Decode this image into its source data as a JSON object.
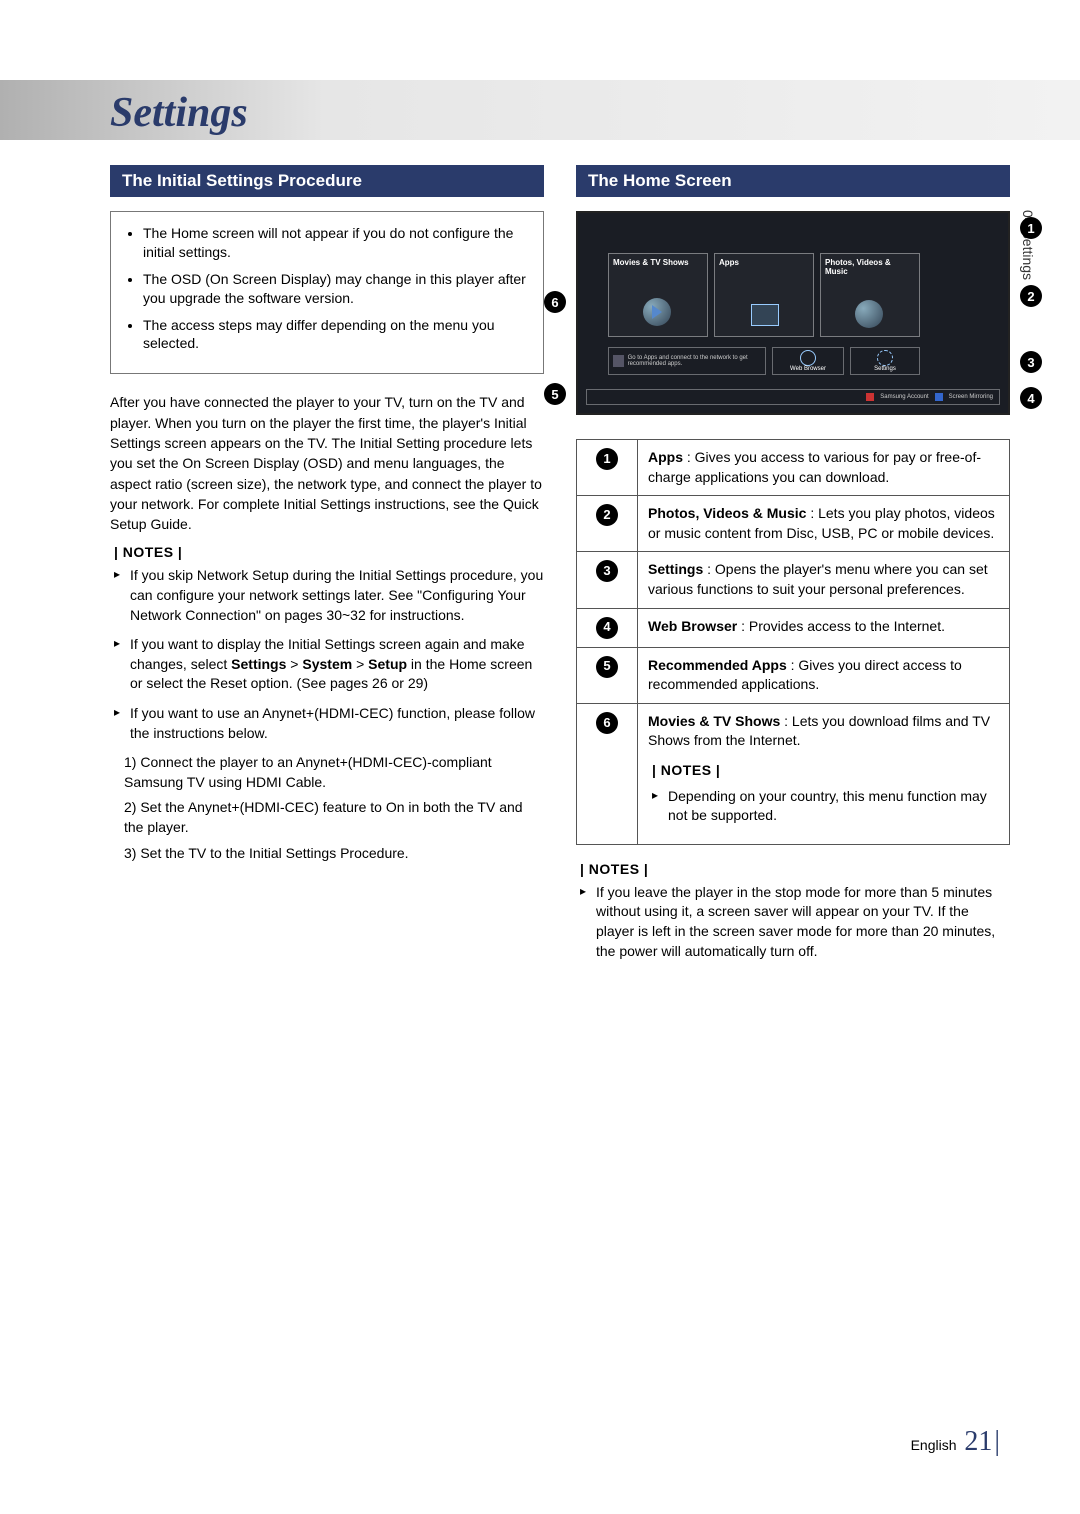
{
  "page_title": "Settings",
  "side_tab": "04   Settings",
  "footer": {
    "lang": "English",
    "page_num": "21"
  },
  "left": {
    "section_title": "The Initial Settings Procedure",
    "box_bullets": [
      "The Home screen will not appear if you do not configure the initial settings.",
      "The OSD (On Screen Display) may change in this player after you upgrade the software version.",
      "The access steps may differ depending on the menu you selected."
    ],
    "body": "After you have connected the player to your TV, turn on the TV and player. When you turn on the player the first time, the player's Initial Settings screen appears on the TV. The Initial Setting procedure lets you set the On Screen Display (OSD) and menu languages, the aspect ratio (screen size), the network type, and connect the player to your network. For complete Initial Settings instructions, see the Quick Setup Guide.",
    "notes_label": "| NOTES |",
    "notes": [
      "If you skip Network Setup during the Initial Settings procedure, you can configure your network settings later. See \"Configuring Your Network Connection\" on pages 30~32 for instructions.",
      "If you want to display the Initial Settings screen again and make changes, select Settings > System > Setup in the Home screen or select the Reset option. (See pages 26 or 29)",
      "If you want to use an Anynet+(HDMI-CEC) function, please follow the instructions below."
    ],
    "sub_steps": [
      "1)  Connect the player to an Anynet+(HDMI-CEC)-compliant Samsung TV using HDMI Cable.",
      "2)  Set the Anynet+(HDMI-CEC) feature to On in both the TV and the player.",
      "3)  Set the TV to the Initial Settings Procedure."
    ]
  },
  "right": {
    "section_title": "The Home Screen",
    "tiles": {
      "movies_tv": "Movies & TV Shows",
      "apps": "Apps",
      "photos": "Photos, Videos & Music",
      "rec_msg": "Go to Apps and connect to the network to get recommended apps.",
      "web_browser": "Web Browser",
      "settings": "Settings",
      "bottom_a": "Samsung Account",
      "bottom_b": "Screen Mirroring"
    },
    "callout_nums": [
      "1",
      "2",
      "3",
      "4",
      "5",
      "6"
    ],
    "legend": [
      {
        "n": "1",
        "bold": "Apps",
        "text": " : Gives you access to various for pay or free-of-charge applications you can download."
      },
      {
        "n": "2",
        "bold": "Photos, Videos & Music",
        "text": " : Lets you play photos, videos or music content from Disc, USB, PC or mobile devices."
      },
      {
        "n": "3",
        "bold": "Settings",
        "text": " : Opens the player's menu where you can set various functions to suit your personal preferences."
      },
      {
        "n": "4",
        "bold": "Web Browser",
        "text": " : Provides access to the Internet."
      },
      {
        "n": "5",
        "bold": "Recommended Apps",
        "text": " : Gives you direct access to recommended applications."
      },
      {
        "n": "6",
        "bold": "Movies & TV Shows",
        "text": " : Lets you download films and TV Shows from the Internet.",
        "note_label": "| NOTES |",
        "note": "Depending on your country, this menu function may not be supported."
      }
    ],
    "notes_label": "| NOTES |",
    "bottom_note": "If you leave the player in the stop mode for more than 5 minutes without using it, a screen saver will appear on your TV. If the player is left in the screen saver mode for more than 20 minutes, the power will automatically turn off."
  }
}
